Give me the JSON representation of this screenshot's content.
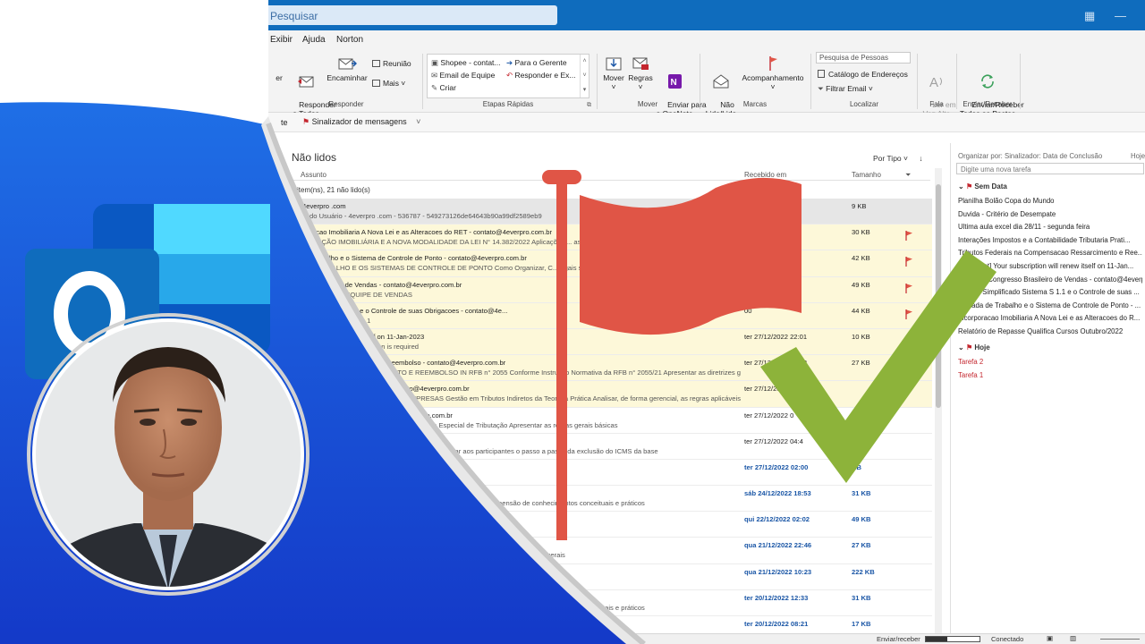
{
  "titlebar": {
    "search_placeholder": "Pesquisar"
  },
  "menu": {
    "items": [
      "Exibir",
      "Ajuda",
      "Norton"
    ]
  },
  "ribbon": {
    "responder": {
      "reply_partial": "er",
      "reply_all": "Responder\na Todos",
      "forward": "Encaminhar",
      "meeting": "Reunião",
      "more": "Mais ˅",
      "group": "Responder"
    },
    "quick_steps": {
      "items": [
        "Shopee - contat...",
        "Email de Equipe",
        "Criar",
        "Para o Gerente",
        "Responder e Ex..."
      ],
      "group": "Etapas Rápidas"
    },
    "move": {
      "move": "Mover",
      "rules": "Regras",
      "onenote": "Enviar para\no OneNote",
      "group": "Mover"
    },
    "tags": {
      "unread": "Não\nLido/Lido",
      "followup": "Acompanhamento",
      "group": "Marcas"
    },
    "find": {
      "people_placeholder": "Pesquisa de Pessoas",
      "address_book": "Catálogo de Endereços",
      "filter": "Filtrar Email ˅",
      "group": "Localizar"
    },
    "speech": {
      "read_aloud": "Ler em\nVoz Alta",
      "group": "Fala"
    },
    "sendrecv": {
      "label": "Enviar/Receber\nTodas as Pastas",
      "group": "Enviar/Receber"
    }
  },
  "qabar": {
    "partial": "te",
    "flag_label": "Sinalizador de mensagens"
  },
  "list": {
    "title": "Não lidos",
    "sort": "Por Tipo ˅",
    "columns": {
      "subject": "Assunto",
      "received": "Recebido em",
      "size": "Tamanho"
    },
    "group_line": "l item(ns), 21 não lido(s)",
    "rows": [
      {
        "s1": "4everpro .com",
        "s2": "zado Usuário - 4everpro .com - 536787 - 549273126de64643b90a99df2589eb9",
        "rc": "06",
        "sz": "9 KB",
        "style": "sel",
        "flag": false
      },
      {
        "s1": "poracao Imobiliaria A Nova Lei e as Alteracoes do RET - contato@4everpro.com.br",
        "s2": "PORAÇÃO IMOBILIÁRIA  E A NOVA MODALIDADE DA LEI N° 14.382/2022  Aplicações ... as da legislação",
        "rc": "3",
        "sz": "30 KB",
        "style": "yellow",
        "flag": true
      },
      {
        "s1": "de Trabalho e o Sistema de Controle de Ponto - contato@4everpro.com.br",
        "s2": "DE TRABALHO  E OS SISTEMAS DE CONTROLE DE PONTO  Como Organizar, C... egais sobre a duração",
        "rc": "4",
        "sz": "42 KB",
        "style": "yellow",
        "flag": true
      },
      {
        "s1": "sso Brasileiro de Vendas - contato@4everpro.com.br",
        "s2": "M TODA SUA EQUIPE DE VENDAS",
        "rc": "1",
        "sz": "49 KB",
        "style": "yellow",
        "flag": true
      },
      {
        "s1": "ndo Sistema S 1.1 e o Controle de suas Obrigacoes - contato@4e...",
        "s2": "CADO Sistema - S-1.1",
        "rc": "00",
        "sz": "44 KB",
        "style": "yellow",
        "flag": true
      },
      {
        "s1": "scription will renew itself on 11-Jan-2023",
        "s2": "ur account active, no action is required",
        "rc": "ter 27/12/2022 22:01",
        "sz": "10 KB",
        "style": "yellow",
        "flag": false
      },
      {
        "s1": "pensacao Ressarcimento e Reembolso - contato@4everpro.com.br",
        "s2": "MPENSAÇÃO  RESSARCIMENTO E REEMBOLSO IN RFB n° 2055  Conforme Instrução Normativa da RFB n° 2055/21  Apresentar as diretrizes gerais",
        "rc": "ter 27/12/2022 12:03",
        "sz": "27 KB",
        "style": "yellow",
        "flag": true
      },
      {
        "s1": "tabilidade Tributaria Pratica - contato@4everpro.com.br",
        "s2": "NTABILIDADE TRIBUTÁRIA NAS EMPRESAS  Gestão em Tributos Indiretos da Teoria a Prática  Analisar, de forma gerencial, as regras aplicáveis",
        "rc": "ter 27/12/2022",
        "sz": "",
        "style": "yellow",
        "flag": true
      },
      {
        "s1": "as Alteracoes do RET - contato@4everpro.com.br",
        "s2": "A LEI N° 14.382/2022  Aplicações no Regime Especial de Tributação  Apresentar as regras gerais básicas",
        "rc": "ter 27/12/2022 0",
        "sz": "",
        "style": "",
        "flag": false
      },
      {
        "s1": "e COFINS - contato@4everpro.com.br",
        "s2": "PIS E COFINS  O presente curso objetiva apresentar aos participantes o passo a passo da exclusão do ICMS da base",
        "rc": "ter 27/12/2022 04:4",
        "sz": "",
        "style": "",
        "flag": false
      },
      {
        "s1": "pro.com.br",
        "s2": "stas",
        "rc": "ter 27/12/2022 02:00",
        "sz": "KB",
        "style": "unread",
        "flag": false
      },
      {
        "s1": "contato@4everpro.com.br",
        "s2": "cimentos Conceituais e Práticos  Propiciar aos participantes a apreensão de conhecimentos conceituais e práticos",
        "rc": "sáb 24/12/2022 18:53",
        "sz": "31 KB",
        "style": "unread",
        "flag": false
      },
      {
        "s1": "",
        "s2": "",
        "rc": "qui 22/12/2022 02:02",
        "sz": "49 KB",
        "style": "unread",
        "flag": false
      },
      {
        "s1": "pro.com.br",
        "s2": "2055  Conforme Instrução Normativa da RFB n° 2055/21  Apresentar as diretrizes gerais",
        "rc": "qua 21/12/2022 22:46",
        "sz": "27 KB",
        "style": "unread",
        "flag": false
      },
      {
        "s1": "",
        "s2": "Indiretos da Teoria a Prática  Analisar, de forma gerencial, as regras aplicáveis aos",
        "rc": "qua 21/12/2022 10:23",
        "sz": "222 KB",
        "style": "unread",
        "flag": false
      },
      {
        "s1": "",
        "s2": "cimentos Conceituais e Práticos  Propiciar aos participantes a apreensão de conhecimentos conceituais e práticos",
        "rc": "ter 20/12/2022 12:33",
        "sz": "31 KB",
        "style": "unread",
        "flag": false
      },
      {
        "s1": "",
        "s2": "",
        "rc": "ter 20/12/2022 08:21",
        "sz": "17 KB",
        "style": "unread",
        "flag": false
      }
    ]
  },
  "todo": {
    "header": "Organizar por: Sinalizador: Data de Conclusão",
    "header_right": "Hoje",
    "new_task_placeholder": "Digite uma nova tarefa",
    "section_nodate": "Sem Data",
    "nodate_items": [
      "Planilha Bolão Copa do Mundo",
      "Duvida - Critério de Desempate",
      "Ultima aula excel dia 28/11 - segunda feira",
      "Interações Impostos e a Contabilidade Tributaria Prati...",
      "Tributos Federais na Compensacao Ressarcimento e Ree...",
      "[Important] Your subscription will renew itself on 11-Jan...",
      "Encontro Congresso Brasileiro de Vendas - contato@4everp...",
      "Esocial Simplificado Sistema S 1.1 e o Controle de suas ...",
      "Jornada de Trabalho e o Sistema de Controle de Ponto - ...",
      "Incorporacao Imobiliaria A Nova Lei e as Alteracoes do R...",
      "Relatório de Repasse Qualifica Cursos Outubro/2022"
    ],
    "section_today": "Hoje",
    "today_items": [
      "Tarefa 2",
      "Tarefa 1"
    ]
  },
  "status": {
    "sendrecv": "Enviar/receber",
    "connected": "Conectado"
  },
  "colors": {
    "titlebar": "#0f6cbd",
    "flag_red": "#e05546",
    "check_green": "#8db33a",
    "unread_blue": "#1a56a6",
    "yellow_row": "#fdf8d9"
  }
}
